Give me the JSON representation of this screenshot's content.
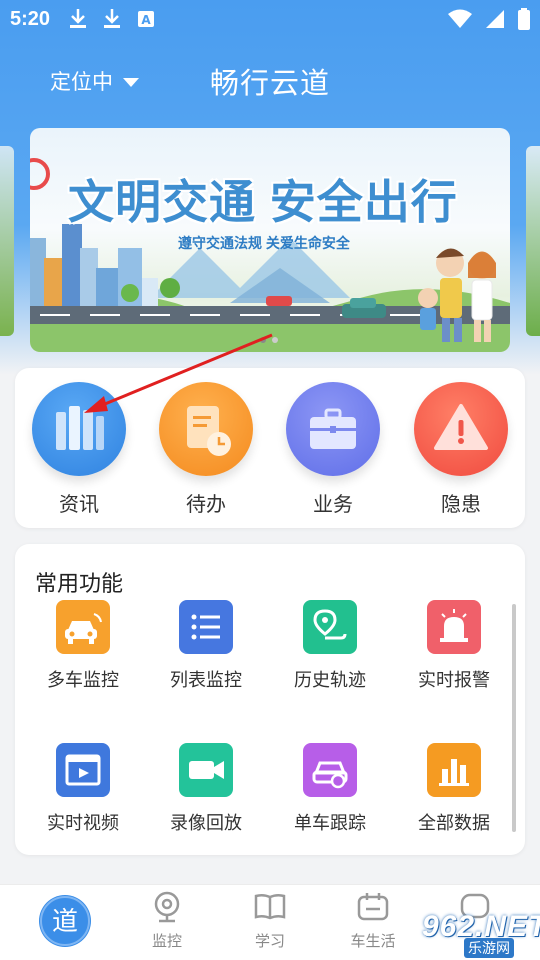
{
  "status_bar": {
    "time": "5:20",
    "notification_icons": [
      "download-icon",
      "download-icon",
      "translate-a-icon"
    ],
    "system_icons": [
      "wifi-icon",
      "signal-icon",
      "battery-icon"
    ]
  },
  "header": {
    "location": "定位中",
    "title": "畅行云道"
  },
  "banner": {
    "headline": "文明交通 安全出行",
    "subtitle": "遵守交通法规 关爱生命安全",
    "page_count": 2,
    "active_page": 1
  },
  "quick_actions": [
    {
      "label": "资讯",
      "icon": "books-icon",
      "color": "#3a8fe6"
    },
    {
      "label": "待办",
      "icon": "task-clock-icon",
      "color": "#f7982f"
    },
    {
      "label": "业务",
      "icon": "briefcase-icon",
      "color": "#6a78ec"
    },
    {
      "label": "隐患",
      "icon": "warning-icon",
      "color": "#f45b4c"
    }
  ],
  "common_functions": {
    "title": "常用功能",
    "items": [
      {
        "label": "多车监控",
        "icon": "multi-car-icon",
        "color": "#f7a12d"
      },
      {
        "label": "列表监控",
        "icon": "list-icon",
        "color": "#4677e0"
      },
      {
        "label": "历史轨迹",
        "icon": "track-pin-icon",
        "color": "#22c08f"
      },
      {
        "label": "实时报警",
        "icon": "alarm-light-icon",
        "color": "#f0606a"
      },
      {
        "label": "实时视频",
        "icon": "video-icon",
        "color": "#3f78dd"
      },
      {
        "label": "录像回放",
        "icon": "video-camera-icon",
        "color": "#23c39a"
      },
      {
        "label": "单车跟踪",
        "icon": "car-target-icon",
        "color": "#b75ee8"
      },
      {
        "label": "全部数据",
        "icon": "bar-chart-icon",
        "color": "#f59b22"
      }
    ]
  },
  "tabbar": {
    "home_label": "道",
    "tabs": [
      {
        "label": "监控",
        "icon": "webcam-icon"
      },
      {
        "label": "学习",
        "icon": "book-icon"
      },
      {
        "label": "车生活",
        "icon": "calendar-icon"
      }
    ]
  },
  "watermark": {
    "text": "962.NET",
    "sub": "乐游网"
  },
  "annotation": {
    "type": "arrow",
    "color": "#e02020"
  }
}
